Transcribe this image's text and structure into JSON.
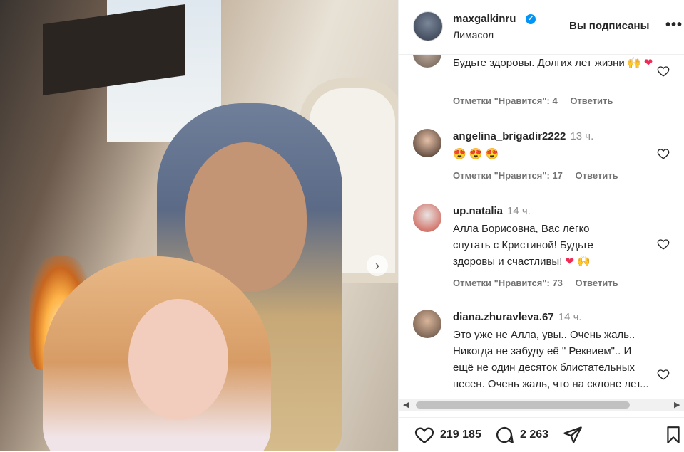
{
  "post": {
    "username": "maxgalkinru",
    "verified_badge": "✔",
    "location": "Лимасол",
    "follow_status": "Вы подписаны",
    "more": "•••"
  },
  "comments": [
    {
      "username": "",
      "time": "",
      "text": "Будьте здоровы. Долгих лет жизни",
      "emoji": [
        "🙌",
        "❤"
      ],
      "likes_label": "Отметки \"Нравится\": 4",
      "reply_label": "Ответить"
    },
    {
      "username": "angelina_brigadir2222",
      "time": "13 ч.",
      "text": "",
      "emoji": [
        "😍",
        "😍",
        "😍"
      ],
      "likes_label": "Отметки \"Нравится\": 17",
      "reply_label": "Ответить"
    },
    {
      "username": "up.natalia",
      "time": "14 ч.",
      "text": "Алла Борисовна, Вас легко спутать с Кристиной! Будьте здоровы и счастливы!",
      "emoji": [
        "❤",
        "🙌"
      ],
      "likes_label": "Отметки \"Нравится\": 73",
      "reply_label": "Ответить"
    },
    {
      "username": "diana.zhuravleva.67",
      "time": "14 ч.",
      "text": "Это уже не Алла, увы.. Очень жаль.. Никогда не забуду её \" Реквием\".. И ещё не один десяток блистательных песен. Очень жаль, что на склоне лет...",
      "emoji": [],
      "likes_label": "",
      "reply_label": ""
    }
  ],
  "actions": {
    "likes_count": "219 185",
    "comments_count": "2 263"
  },
  "icons": {
    "carousel_next": "chevron-right-icon",
    "like": "heart-outline-icon",
    "comment": "speech-bubble-icon",
    "share": "paper-plane-icon",
    "save": "bookmark-icon"
  },
  "colors": {
    "verified": "#0095f6",
    "heart": "#ed2d56",
    "text": "#262626",
    "muted": "#737373"
  }
}
